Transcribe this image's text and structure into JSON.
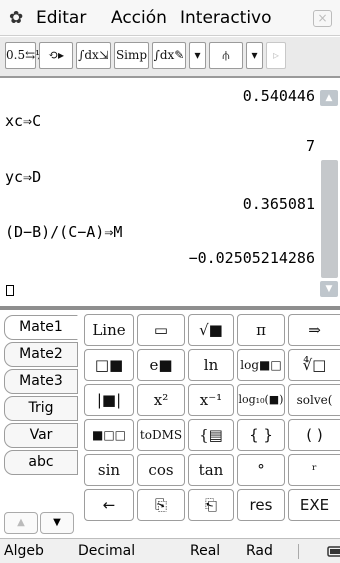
{
  "menubar": {
    "gear_icon": "gear-icon",
    "items": [
      "Editar",
      "Acción",
      "Interactivo"
    ],
    "close_label": "×"
  },
  "toolbar": {
    "buttons": [
      "0.5⇆½",
      "⟲▸",
      "∫dx⇲",
      "Simp",
      "∫dx✎",
      "▾",
      "⫛",
      "▾",
      "▹"
    ]
  },
  "work": {
    "lines": [
      {
        "text": "0.540446",
        "align": "right"
      },
      {
        "text": "xc⇒C",
        "align": "left"
      },
      {
        "text": "7",
        "align": "right"
      },
      {
        "text": "yc⇒D",
        "align": "left"
      },
      {
        "text": "0.365081",
        "align": "right"
      },
      {
        "text": "(D−B)/(C−A)⇒M",
        "align": "left"
      },
      {
        "text": "−0.02505214286",
        "align": "right"
      }
    ]
  },
  "keyboard": {
    "tabs": [
      "Mate1",
      "Mate2",
      "Mate3",
      "Trig",
      "Var",
      "abc"
    ],
    "active_tab": "Mate1",
    "rows": [
      [
        "Line",
        "▭",
        "√■",
        "π",
        "⇒"
      ],
      [
        "□■",
        "e■",
        "ln",
        "log■□",
        "∜□"
      ],
      [
        "|■|",
        "x²",
        "x⁻¹",
        "log₁₀(■)",
        "solve("
      ],
      [
        "■□□",
        "toDMS",
        "{▤",
        "{ }",
        "( )"
      ],
      [
        "sin",
        "cos",
        "tan",
        "°",
        "ʳ"
      ],
      [
        "←",
        "⎘",
        "⎗",
        "res",
        "EXE"
      ]
    ],
    "scroll_up": "▲",
    "scroll_down": "▼"
  },
  "status": {
    "items": [
      "Algeb",
      "Decimal",
      "Real",
      "Rad"
    ],
    "battery_icon": "battery-icon"
  }
}
